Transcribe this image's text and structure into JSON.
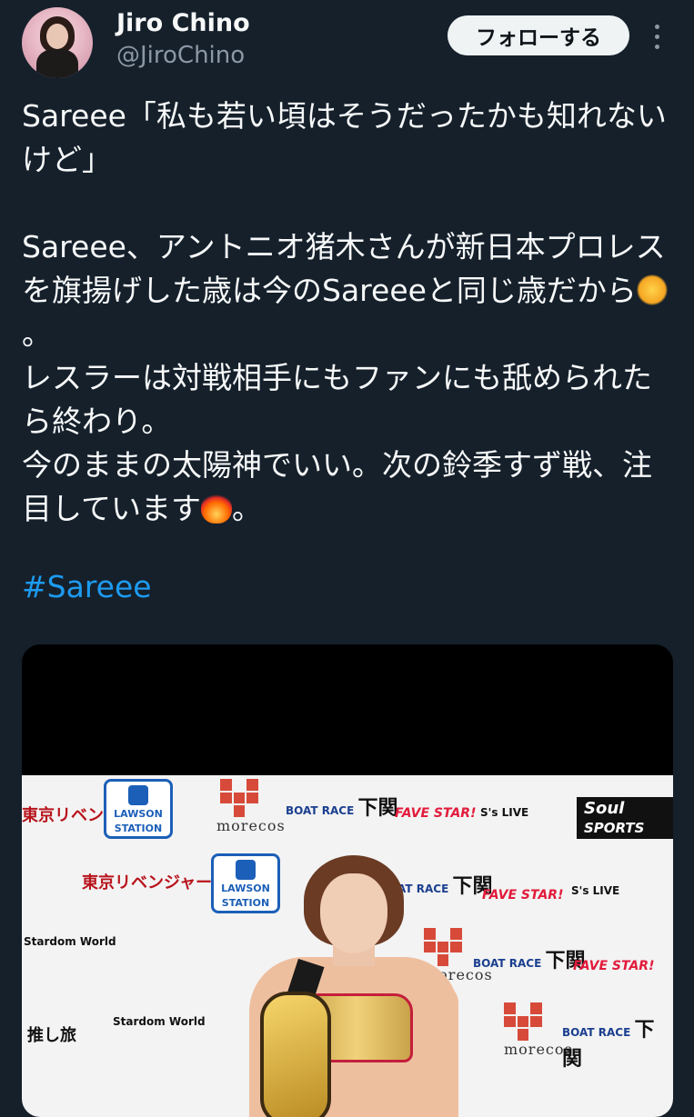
{
  "author": {
    "name": "Jiro Chino",
    "handle": "@JiroChino"
  },
  "actions": {
    "follow_label": "フォローする"
  },
  "tweet": {
    "line1": "Sareee「私も若い頃はそうだったかも知れないけど」",
    "para2_part1": "Sareee、アントニオ猪木さんが新日本プロレスを旗揚げした歳は今のSareeeと同じ歳だから",
    "para2_part1_end": "。",
    "para2_part2": "レスラーは対戦相手にもファンにも舐められたら終わり。",
    "para2_part3": "今のままの太陽神でいい。次の鈴季すず戦、注目しています",
    "para2_part3_end": "。",
    "hashtag": "#Sareee",
    "emoji": [
      "sun-emoji",
      "fire-emoji"
    ]
  },
  "media": {
    "backdrop_logos": {
      "lawson": "LAWSON STATION",
      "morecos": "morecos",
      "boat_race": "BOAT RACE",
      "shimonoseki": "下関",
      "fave_star": "FAVE STAR!",
      "ss_live": "S's LIVE",
      "soul_sports": "Soul",
      "soul_sports_sub": "SPORTS",
      "tokyo_revengers": "東京リベンジャーズ",
      "stardom_world": "Stardom World",
      "oshi_tabi": "推し旅"
    }
  }
}
